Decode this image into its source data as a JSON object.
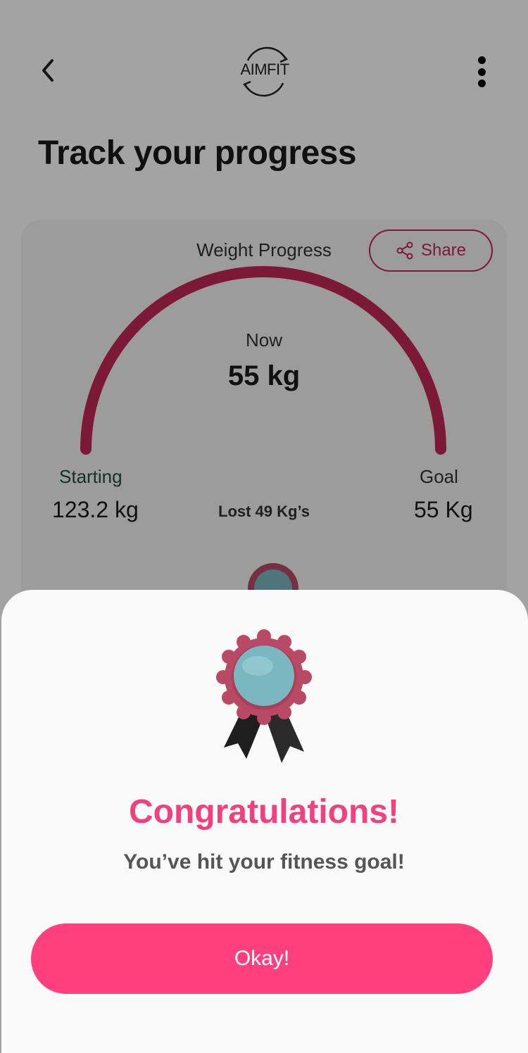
{
  "header": {
    "logo_text": "AIMFIT",
    "back_icon": "chevron-left-icon",
    "menu_icon": "more-vertical-icon"
  },
  "page": {
    "title": "Track your progress"
  },
  "weight_card": {
    "title": "Weight Progress",
    "share_label": "Share",
    "share_icon": "share-icon",
    "now_label": "Now",
    "now_value": "55 kg",
    "starting_label": "Starting",
    "starting_value": "123.2 kg",
    "lost_text": "Lost 49 Kg’s",
    "goal_label": "Goal",
    "goal_value": "55 Kg",
    "progress_fraction": 1.0
  },
  "dialog": {
    "badge_icon": "award-ribbon-icon",
    "title": "Congratulations!",
    "message": "You’ve hit your fitness goal!",
    "ok_label": "Okay!"
  },
  "colors": {
    "accent": "#ff3f7e",
    "arc": "#c2285a",
    "title_pink": "#f0407e",
    "medal_teal": "#7bb7c0",
    "medal_rim": "#b84a66"
  }
}
